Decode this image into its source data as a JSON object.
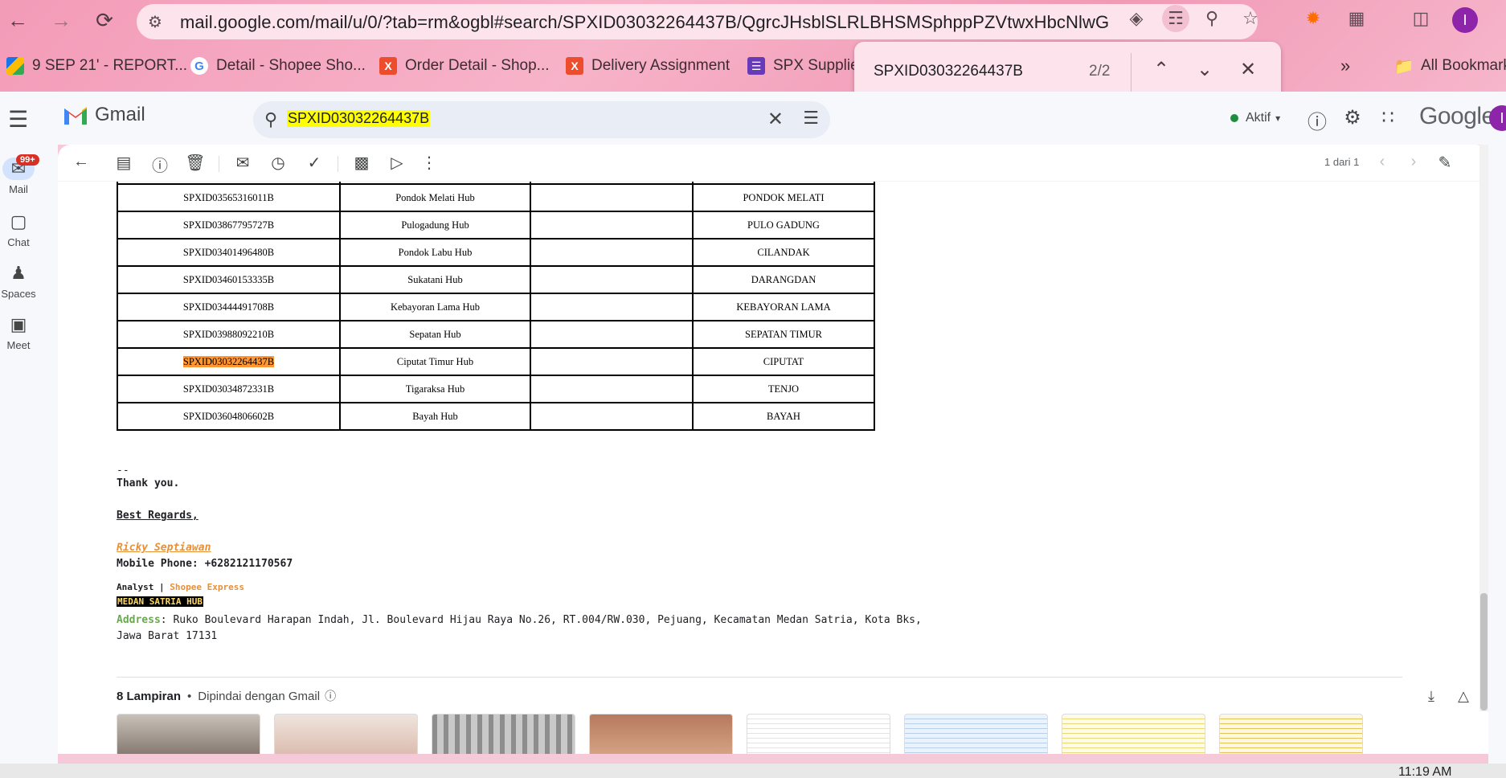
{
  "browser": {
    "url": "mail.google.com/mail/u/0/?tab=rm&ogbl#search/SPXID03032264437B/QgrcJHsblSLRLBHSMSphppPZVtwxHbcNlwG",
    "profile_initial": "I",
    "bookmarks": [
      {
        "label": "9 SEP 21' - REPORT...",
        "icon": "drive-icon"
      },
      {
        "label": "Detail - Shopee Sho...",
        "icon": "google-icon"
      },
      {
        "label": "Order Detail - Shop...",
        "icon": "x-icon"
      },
      {
        "label": "Delivery Assignment",
        "icon": "x-icon"
      },
      {
        "label": "SPX Supplies",
        "icon": "form-icon"
      }
    ],
    "all_bookmarks": "All Bookmarks",
    "find": {
      "query": "SPXID03032264437B",
      "count": "2/2"
    }
  },
  "gmail": {
    "logo_text": "Gmail",
    "search_value": "SPXID03032264437B",
    "status": "Aktif",
    "google_wordmark": "Google",
    "avatar_initial": "I",
    "rail": {
      "mail": "Mail",
      "mail_badge": "99+",
      "chat": "Chat",
      "spaces": "Spaces",
      "meet": "Meet"
    },
    "pager": "1 dari 1"
  },
  "email": {
    "table_rows": [
      [
        "SPXID03565316011B",
        "Pondok Melati Hub",
        "",
        "PONDOK MELATI"
      ],
      [
        "SPXID03867795727B",
        "Pulogadung Hub",
        "",
        "PULO GADUNG"
      ],
      [
        "SPXID03401496480B",
        "Pondok Labu Hub",
        "",
        "CILANDAK"
      ],
      [
        "SPXID03460153335B",
        "Sukatani Hub",
        "",
        "DARANGDAN"
      ],
      [
        "SPXID03444491708B",
        "Kebayoran Lama Hub",
        "",
        "KEBAYORAN LAMA"
      ],
      [
        "SPXID03988092210B",
        "Sepatan Hub",
        "",
        "SEPATAN TIMUR"
      ],
      [
        "SPXID03032264437B",
        "Ciputat Timur Hub",
        "",
        "CIPUTAT"
      ],
      [
        "SPXID03034872331B",
        "Tigaraksa Hub",
        "",
        "TENJO"
      ],
      [
        "SPXID03604806602B",
        "Bayah Hub",
        "",
        "BAYAH"
      ]
    ],
    "highlight_row": 6,
    "signature": {
      "dashes": "--",
      "thanks": "Thank you.",
      "regards": "Best Regards,",
      "name": "Ricky Septiawan ",
      "phone": "Mobile Phone: +6282121170567",
      "role_prefix": "Analyst | ",
      "company": "Shopee Express",
      "hub": "MEDAN SATRIA HUB",
      "address_label": "Address",
      "address_line1": ": Ruko Boulevard Harapan Indah, Jl. Boulevard Hijau Raya No.26, RT.004/RW.030, Pejuang, Kecamatan Medan Satria, Kota Bks,",
      "address_line2": "Jawa Barat 17131"
    },
    "attachments": {
      "count_label": "8 Lampiran",
      "scan_label": "Dipindai dengan Gmail"
    }
  },
  "system": {
    "clock": "11:19 AM"
  },
  "colors": {
    "search_highlight": "#ffff00",
    "active_match": "#ff9632",
    "chrome": "#f39bb8"
  }
}
